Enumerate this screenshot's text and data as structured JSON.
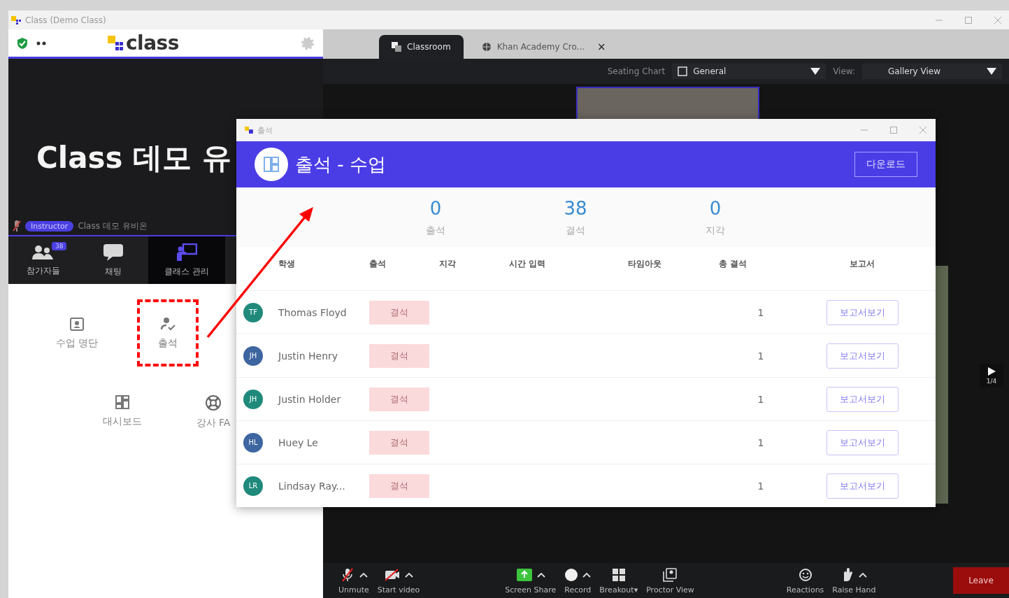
{
  "window": {
    "title": "Class (Demo Class)"
  },
  "class_panel": {
    "logo": "class",
    "video_title": "Class 데모 유",
    "role_badge": "Instructor",
    "host_name": "Class 데모 유비온",
    "tabs": [
      {
        "label": "참가자들",
        "badge": "38",
        "selected": false
      },
      {
        "label": "채팅",
        "selected": false
      },
      {
        "label": "클래스 관리",
        "selected": true
      }
    ],
    "tools": [
      {
        "label": "수업 명단",
        "highlighted": false
      },
      {
        "label": "출석",
        "highlighted": true
      },
      {
        "label": "대시보드",
        "highlighted": false
      },
      {
        "label": "강사 FA",
        "highlighted": false
      }
    ]
  },
  "meeting": {
    "tabs": [
      {
        "label": "Classroom",
        "selected": true
      },
      {
        "label": "Khan Academy Cro...",
        "selected": false,
        "close": "×"
      }
    ],
    "seating_chart_label": "Seating Chart",
    "seating_chart": "General",
    "view_label": "View:",
    "view": "Gallery View",
    "page": "1/4",
    "toolbar": [
      {
        "label": "Unmute",
        "kind": "mic",
        "menu": true
      },
      {
        "label": "Start video",
        "kind": "video",
        "menu": true
      },
      {
        "label": "Screen Share",
        "kind": "share",
        "menu": true
      },
      {
        "label": "Record",
        "kind": "record",
        "menu": true
      },
      {
        "label": "Breakout▾",
        "kind": "breakout",
        "menu": false
      },
      {
        "label": "Proctor View",
        "kind": "proctor",
        "menu": false
      },
      {
        "label": "Reactions",
        "kind": "reactions",
        "menu": false
      },
      {
        "label": "Raise Hand",
        "kind": "hand",
        "menu": true
      },
      {
        "label": "Leave",
        "kind": "leave",
        "menu": false
      }
    ]
  },
  "attendance_dialog": {
    "window_title": "출석",
    "title": "출석 - 수업",
    "download": "다운로드",
    "stats": [
      {
        "value": "0",
        "label": "출석"
      },
      {
        "value": "38",
        "label": "결석"
      },
      {
        "value": "0",
        "label": "지각"
      }
    ],
    "columns": [
      "학생",
      "출석",
      "지각",
      "시간 입력",
      "타임아웃",
      "총 결석",
      "보고서"
    ],
    "rows": [
      {
        "initials": "TF",
        "color": "#1f8a7c",
        "name": "Thomas Floyd",
        "status": "결석",
        "total": "1",
        "report": "보고서보기"
      },
      {
        "initials": "JH",
        "color": "#3d65a0",
        "name": "Justin Henry",
        "status": "결석",
        "total": "1",
        "report": "보고서보기"
      },
      {
        "initials": "JH",
        "color": "#1f8a7c",
        "name": "Justin Holder",
        "status": "결석",
        "total": "1",
        "report": "보고서보기"
      },
      {
        "initials": "HL",
        "color": "#3d65a0",
        "name": "Huey Le",
        "status": "결석",
        "total": "1",
        "report": "보고서보기"
      },
      {
        "initials": "LR",
        "color": "#1f8a7c",
        "name": "Lindsay Ray...",
        "status": "결석",
        "total": "1",
        "report": "보고서보기"
      }
    ]
  }
}
